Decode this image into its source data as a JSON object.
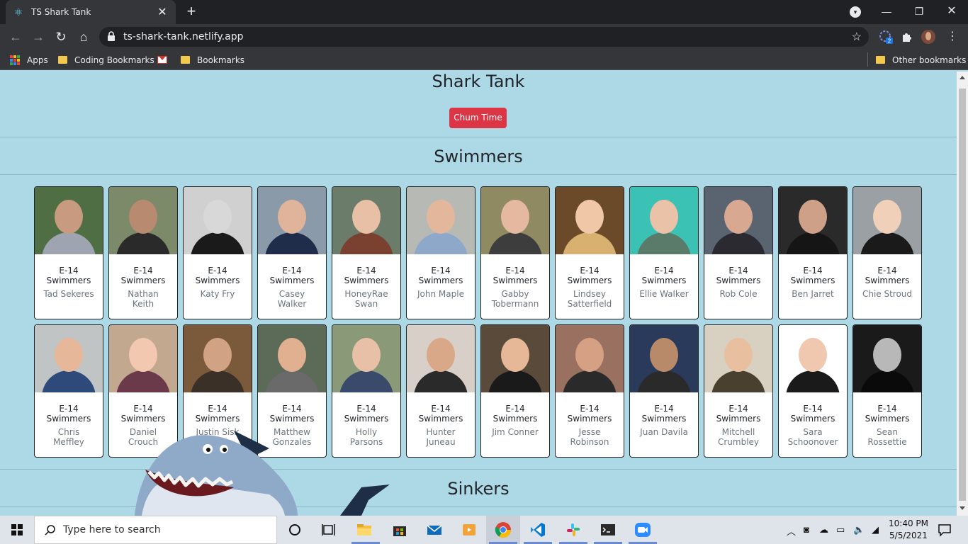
{
  "browser": {
    "tab_title": "TS Shark Tank",
    "url": "ts-shark-tank.netlify.app",
    "extension_badge": "2",
    "bookmarks": {
      "apps": "Apps",
      "coding": "Coding Bookmarks",
      "bookmarks": "Bookmarks",
      "other": "Other bookmarks"
    }
  },
  "page": {
    "title": "Shark Tank",
    "chum_button": "Chum Time",
    "swimmers_heading": "Swimmers",
    "sinkers_heading": "Sinkers",
    "swimmers": [
      {
        "cohort": "E-14",
        "role": "Swimmers",
        "name": "Tad Sekeres",
        "bg": "#4f6e44",
        "skin": "#c89b80",
        "shirt": "#9ea5b0"
      },
      {
        "cohort": "E-14",
        "role": "Swimmers",
        "name": "Nathan Keith",
        "bg": "#7d8a6a",
        "skin": "#b88a6f",
        "shirt": "#2a2a2a"
      },
      {
        "cohort": "E-14",
        "role": "Swimmers",
        "name": "Katy Fry",
        "bg": "#d0d0d0",
        "skin": "#d8d8d8",
        "shirt": "#1a1a1a"
      },
      {
        "cohort": "E-14",
        "role": "Swimmers",
        "name": "Casey Walker",
        "bg": "#8a9aa8",
        "skin": "#e0b49a",
        "shirt": "#1f2c4a"
      },
      {
        "cohort": "E-14",
        "role": "Swimmers",
        "name": "HoneyRae Swan",
        "bg": "#6b7d6a",
        "skin": "#e8c0a5",
        "shirt": "#7a4030"
      },
      {
        "cohort": "E-14",
        "role": "Swimmers",
        "name": "John Maple",
        "bg": "#b7b9b4",
        "skin": "#e3b79c",
        "shirt": "#8da8c8"
      },
      {
        "cohort": "E-14",
        "role": "Swimmers",
        "name": "Gabby Tobermann",
        "bg": "#8f8a62",
        "skin": "#e4b9a0",
        "shirt": "#3d3d3d"
      },
      {
        "cohort": "E-14",
        "role": "Swimmers",
        "name": "Lindsey Satterfield",
        "bg": "#6b4a2a",
        "skin": "#f0c8a8",
        "shirt": "#d8b070"
      },
      {
        "cohort": "E-14",
        "role": "Swimmers",
        "name": "Ellie Walker",
        "bg": "#3cc2b4",
        "skin": "#e9c2a8",
        "shirt": "#5a7a6a"
      },
      {
        "cohort": "E-14",
        "role": "Swimmers",
        "name": "Rob Cole",
        "bg": "#5a6470",
        "skin": "#d8a890",
        "shirt": "#2a2a30"
      },
      {
        "cohort": "E-14",
        "role": "Swimmers",
        "name": "Ben Jarret",
        "bg": "#2a2a2a",
        "skin": "#cfa088",
        "shirt": "#151515"
      },
      {
        "cohort": "E-14",
        "role": "Swimmers",
        "name": "Chie Stroud",
        "bg": "#9aa0a4",
        "skin": "#f0d0b8",
        "shirt": "#1a1a1a"
      },
      {
        "cohort": "E-14",
        "role": "Swimmers",
        "name": "Chris Meffley",
        "bg": "#c0c4c4",
        "skin": "#e6b798",
        "shirt": "#2e4a7a"
      },
      {
        "cohort": "E-14",
        "role": "Swimmers",
        "name": "Daniel Crouch",
        "bg": "#c2a88e",
        "skin": "#f2c8b0",
        "shirt": "#6a3a4a"
      },
      {
        "cohort": "E-14",
        "role": "Swimmers",
        "name": "Justin Sisk",
        "bg": "#7a5a3a",
        "skin": "#d2a284",
        "shirt": "#3a3028"
      },
      {
        "cohort": "E-14",
        "role": "Swimmers",
        "name": "Matthew Gonzales",
        "bg": "#5c6a58",
        "skin": "#e0b090",
        "shirt": "#6a6a6a"
      },
      {
        "cohort": "E-14",
        "role": "Swimmers",
        "name": "Holly Parsons",
        "bg": "#8a9a78",
        "skin": "#e8c0a8",
        "shirt": "#3a4a6a"
      },
      {
        "cohort": "E-14",
        "role": "Swimmers",
        "name": "Hunter Juneau",
        "bg": "#d8d0c8",
        "skin": "#d8a888",
        "shirt": "#2a2a2a"
      },
      {
        "cohort": "E-14",
        "role": "Swimmers",
        "name": "Jim Conner",
        "bg": "#5a4a3a",
        "skin": "#e6b898",
        "shirt": "#1a1a1a"
      },
      {
        "cohort": "E-14",
        "role": "Swimmers",
        "name": "Jesse Robinson",
        "bg": "#9a7060",
        "skin": "#d6a084",
        "shirt": "#2a2a2a"
      },
      {
        "cohort": "E-14",
        "role": "Swimmers",
        "name": "Juan Davila",
        "bg": "#2a3a5a",
        "skin": "#b88a6a",
        "shirt": "#2a2a2a"
      },
      {
        "cohort": "E-14",
        "role": "Swimmers",
        "name": "Mitchell Crumbley",
        "bg": "#d8d0c0",
        "skin": "#e8c0a0",
        "shirt": "#4a4030"
      },
      {
        "cohort": "E-14",
        "role": "Swimmers",
        "name": "Sara Schoonover",
        "bg": "#ffffff",
        "skin": "#f0c8b0",
        "shirt": "#1a1a1a"
      },
      {
        "cohort": "E-14",
        "role": "Swimmers",
        "name": "Sean Rossettie",
        "bg": "#1a1a1a",
        "skin": "#b8b8b8",
        "shirt": "#0a0a0a"
      }
    ]
  },
  "taskbar": {
    "search_placeholder": "Type here to search",
    "time": "10:40 PM",
    "date": "5/5/2021"
  }
}
